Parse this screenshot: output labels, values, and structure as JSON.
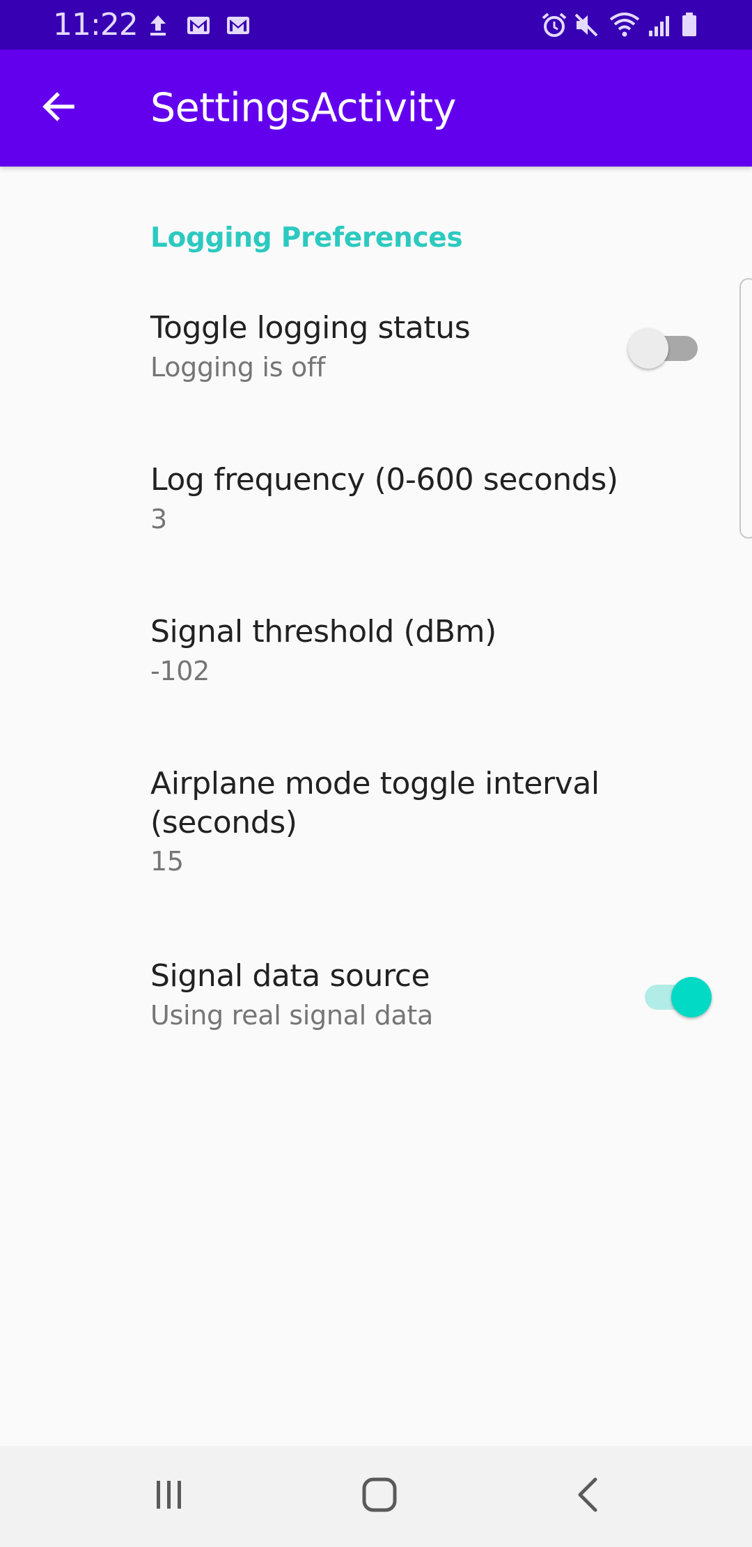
{
  "status_bar": {
    "time": "11:22",
    "left_icons": [
      "upload-icon",
      "gmail-icon",
      "gmail-icon"
    ],
    "right_icons": [
      "alarm-icon",
      "mute-icon",
      "wifi-icon",
      "signal-icon",
      "battery-icon"
    ]
  },
  "app_bar": {
    "title": "SettingsActivity",
    "back_icon": "arrow-back-icon",
    "background": "#6200EE"
  },
  "preferences": {
    "category_title": "Logging Preferences",
    "items": [
      {
        "title": "Toggle logging status",
        "summary": "Logging is off",
        "widget": "switch",
        "checked": false
      },
      {
        "title": "Log frequency (0-600 seconds)",
        "summary": "3"
      },
      {
        "title": "Signal threshold (dBm)",
        "summary": "-102"
      },
      {
        "title": "Airplane mode toggle interval (seconds)",
        "summary": "15"
      },
      {
        "title": "Signal data source",
        "summary": "Using real signal data",
        "widget": "switch",
        "checked": true
      }
    ]
  },
  "nav_bar": {
    "buttons": [
      "recent-apps-icon",
      "home-icon",
      "back-icon"
    ]
  },
  "colors": {
    "status_bar": "#3700B3",
    "primary": "#6200EE",
    "accent": "#03DAC5",
    "category": "#2CC9C0"
  }
}
